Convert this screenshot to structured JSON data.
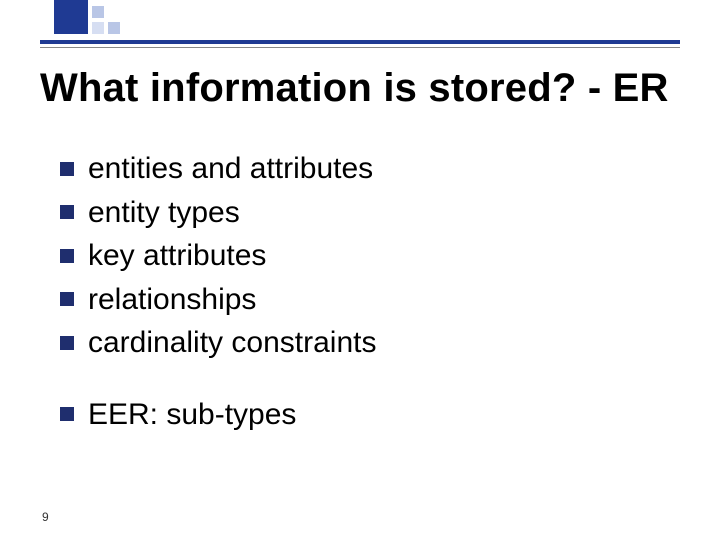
{
  "title": "What information is stored? - ER",
  "bullets_group1": [
    {
      "text": "entities and attributes"
    },
    {
      "text": "entity types"
    },
    {
      "text": "key attributes"
    },
    {
      "text": "relationships"
    },
    {
      "text": "cardinality constraints"
    }
  ],
  "bullets_group2": [
    {
      "text": "EER: sub-types"
    }
  ],
  "page_number": "9"
}
